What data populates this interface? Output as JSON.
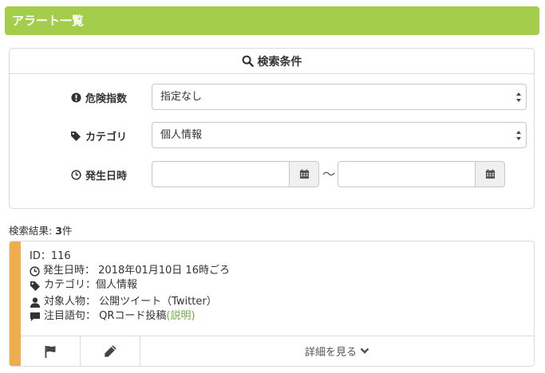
{
  "header": {
    "title": "アラート一覧"
  },
  "search": {
    "title": "検索条件",
    "danger_label": "危険指数",
    "danger_value": "指定なし",
    "category_label": "カテゴリ",
    "category_value": "個人情報",
    "date_label": "発生日時",
    "date_from": "",
    "date_to": "",
    "tilde": "〜"
  },
  "results": {
    "prefix": "検索結果: ",
    "count": "3",
    "suffix": "件"
  },
  "alert": {
    "id_line": "ID：116",
    "date_line": "発生日時：  2018年01月10日 16時ごろ",
    "category_line": "カテゴリ：個人情報",
    "target_line": "対象人物：  公開ツイート（Twitter）",
    "keyword_line": "注目語句：  QRコード投稿 ",
    "explain_link": "(説明)",
    "detail_label": "詳細を見る"
  },
  "colors": {
    "header_bg": "#a3cd4a",
    "stripe": "#f0ad4e",
    "link": "#6fae3e"
  }
}
